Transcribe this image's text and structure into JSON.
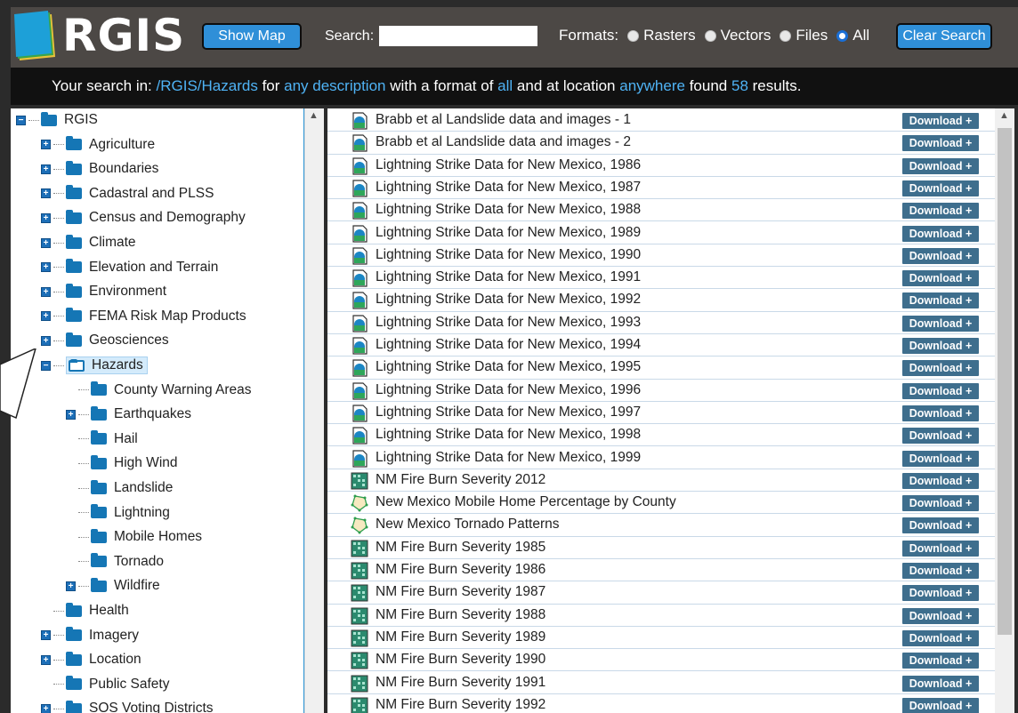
{
  "header": {
    "brand": "RGIS",
    "show_map_label": "Show Map",
    "search_label": "Search:",
    "search_value": "",
    "formats_label": "Formats:",
    "formats": [
      {
        "label": "Rasters",
        "checked": false
      },
      {
        "label": "Vectors",
        "checked": false
      },
      {
        "label": "Files",
        "checked": false
      },
      {
        "label": "All",
        "checked": true
      }
    ],
    "clear_search_label": "Clear Search"
  },
  "search_summary": {
    "prefix": "Your search in:",
    "path": "/RGIS/Hazards",
    "for": "for",
    "description": "any description",
    "with_format": "with a format of",
    "format": "all",
    "at_location": "and at location",
    "location": "anywhere",
    "found": "found",
    "count": "58",
    "results": "results."
  },
  "tree": {
    "root": "RGIS",
    "items": [
      {
        "label": "Agriculture",
        "level": 1,
        "expandable": true
      },
      {
        "label": "Boundaries",
        "level": 1,
        "expandable": true
      },
      {
        "label": "Cadastral and PLSS",
        "level": 1,
        "expandable": true
      },
      {
        "label": "Census and Demography",
        "level": 1,
        "expandable": true
      },
      {
        "label": "Climate",
        "level": 1,
        "expandable": true
      },
      {
        "label": "Elevation and Terrain",
        "level": 1,
        "expandable": true
      },
      {
        "label": "Environment",
        "level": 1,
        "expandable": true
      },
      {
        "label": "FEMA Risk Map Products",
        "level": 1,
        "expandable": true
      },
      {
        "label": "Geosciences",
        "level": 1,
        "expandable": true
      },
      {
        "label": "Hazards",
        "level": 1,
        "expandable": true,
        "open": true,
        "selected": true
      },
      {
        "label": "County Warning Areas",
        "level": 2,
        "expandable": false
      },
      {
        "label": "Earthquakes",
        "level": 2,
        "expandable": true
      },
      {
        "label": "Hail",
        "level": 2,
        "expandable": false
      },
      {
        "label": "High Wind",
        "level": 2,
        "expandable": false
      },
      {
        "label": "Landslide",
        "level": 2,
        "expandable": false
      },
      {
        "label": "Lightning",
        "level": 2,
        "expandable": false
      },
      {
        "label": "Mobile Homes",
        "level": 2,
        "expandable": false
      },
      {
        "label": "Tornado",
        "level": 2,
        "expandable": false
      },
      {
        "label": "Wildfire",
        "level": 2,
        "expandable": true
      },
      {
        "label": "Health",
        "level": 1,
        "expandable": false
      },
      {
        "label": "Imagery",
        "level": 1,
        "expandable": true
      },
      {
        "label": "Location",
        "level": 1,
        "expandable": true
      },
      {
        "label": "Public Safety",
        "level": 1,
        "expandable": false
      },
      {
        "label": "SOS Voting Districts",
        "level": 1,
        "expandable": true
      }
    ]
  },
  "results": {
    "download_label": "Download +",
    "rows": [
      {
        "title": "Brabb et al Landslide data and images - 1",
        "type": "file"
      },
      {
        "title": "Brabb et al Landslide data and images - 2",
        "type": "file"
      },
      {
        "title": "Lightning Strike Data for New Mexico, 1986",
        "type": "file"
      },
      {
        "title": "Lightning Strike Data for New Mexico, 1987",
        "type": "file"
      },
      {
        "title": "Lightning Strike Data for New Mexico, 1988",
        "type": "file"
      },
      {
        "title": "Lightning Strike Data for New Mexico, 1989",
        "type": "file"
      },
      {
        "title": "Lightning Strike Data for New Mexico, 1990",
        "type": "file"
      },
      {
        "title": "Lightning Strike Data for New Mexico, 1991",
        "type": "file"
      },
      {
        "title": "Lightning Strike Data for New Mexico, 1992",
        "type": "file"
      },
      {
        "title": "Lightning Strike Data for New Mexico, 1993",
        "type": "file"
      },
      {
        "title": "Lightning Strike Data for New Mexico, 1994",
        "type": "file"
      },
      {
        "title": "Lightning Strike Data for New Mexico, 1995",
        "type": "file"
      },
      {
        "title": "Lightning Strike Data for New Mexico, 1996",
        "type": "file"
      },
      {
        "title": "Lightning Strike Data for New Mexico, 1997",
        "type": "file"
      },
      {
        "title": "Lightning Strike Data for New Mexico, 1998",
        "type": "file"
      },
      {
        "title": "Lightning Strike Data for New Mexico, 1999",
        "type": "file"
      },
      {
        "title": "NM Fire Burn Severity 2012",
        "type": "raster"
      },
      {
        "title": "New Mexico Mobile Home Percentage by County",
        "type": "vector"
      },
      {
        "title": "New Mexico Tornado Patterns",
        "type": "vector"
      },
      {
        "title": "NM Fire Burn Severity 1985",
        "type": "raster"
      },
      {
        "title": "NM Fire Burn Severity 1986",
        "type": "raster"
      },
      {
        "title": "NM Fire Burn Severity 1987",
        "type": "raster"
      },
      {
        "title": "NM Fire Burn Severity 1988",
        "type": "raster"
      },
      {
        "title": "NM Fire Burn Severity 1989",
        "type": "raster"
      },
      {
        "title": "NM Fire Burn Severity 1990",
        "type": "raster"
      },
      {
        "title": "NM Fire Burn Severity 1991",
        "type": "raster"
      },
      {
        "title": "NM Fire Burn Severity 1992",
        "type": "raster"
      }
    ]
  },
  "colors": {
    "header_bg": "#4c4845",
    "accent_blue": "#2f8fd8",
    "highlight_text": "#4fb3f5",
    "download_bg": "#3e6e8d",
    "folder_blue": "#1576b5"
  }
}
